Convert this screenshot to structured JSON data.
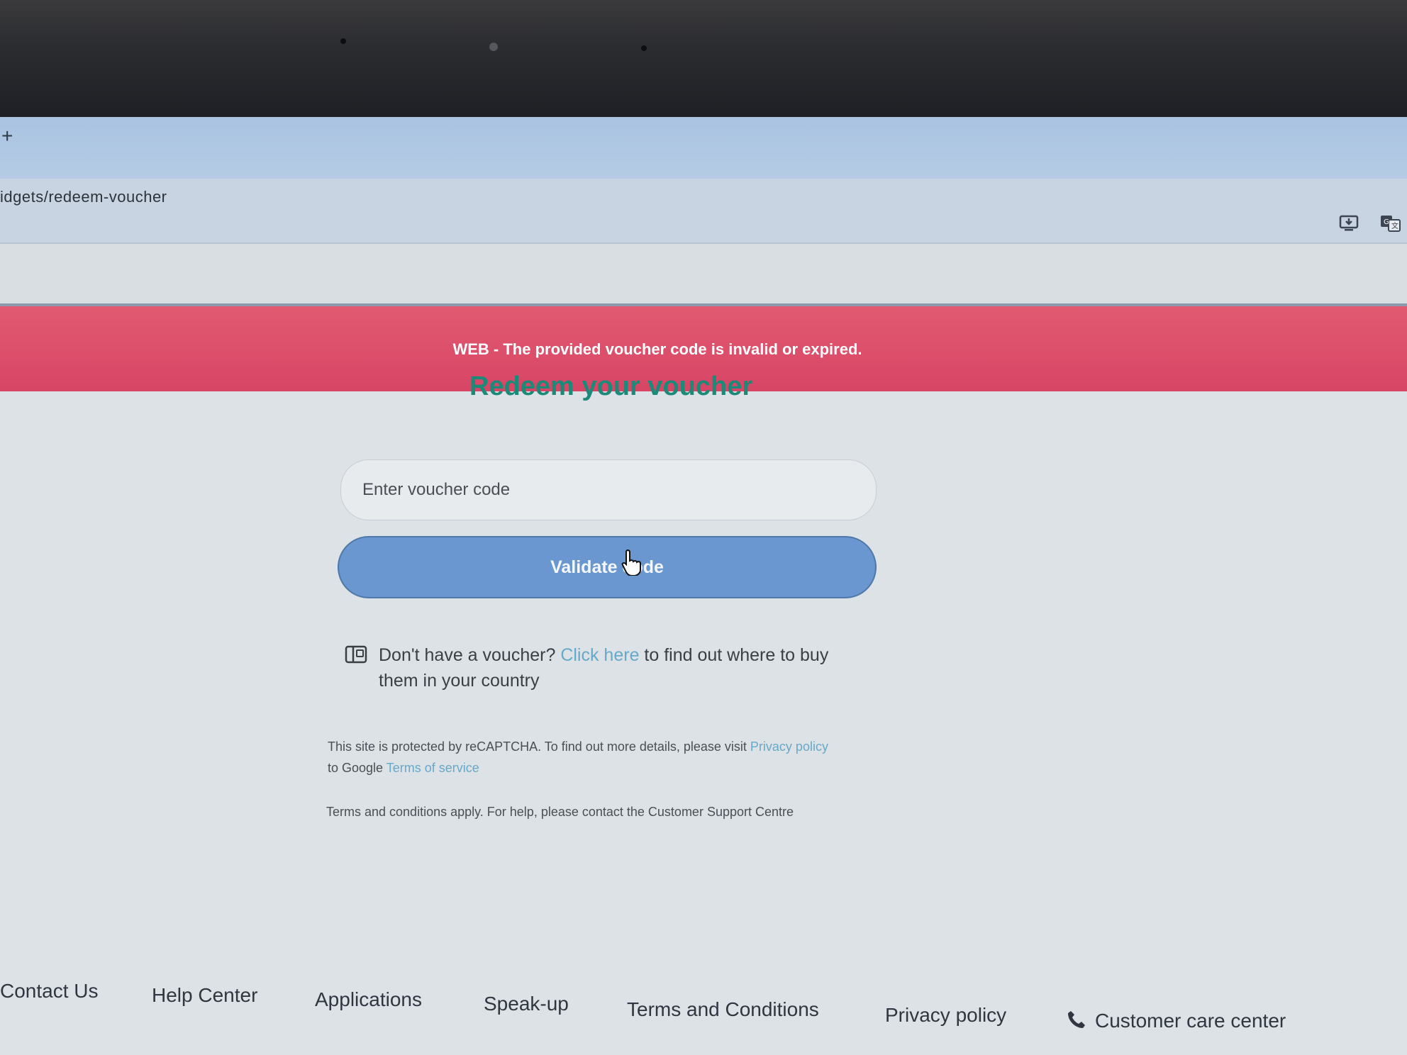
{
  "browser": {
    "new_tab_label": "+",
    "url": "idgets/redeem-voucher",
    "toolbar_icons": [
      "install-app-icon",
      "translate-icon"
    ]
  },
  "alert": {
    "message": "WEB - The provided voucher code is invalid or expired.",
    "color": "#d84566"
  },
  "form": {
    "title": "Redeem your voucher",
    "input_placeholder": "Enter voucher code",
    "submit_label": "Validate code",
    "accent_color": "#1b8a78",
    "button_color": "#6a97cf"
  },
  "info": {
    "icon": "voucher-icon",
    "prefix": "Don't have a voucher? ",
    "link": "Click here",
    "suffix": " to find out where to buy them in your country"
  },
  "recaptcha": {
    "prefix": "This site is protected by reCAPTCHA. To find out more details, please visit ",
    "privacy_link": "Privacy policy",
    "middle": " to Google ",
    "terms_link": "Terms of service"
  },
  "terms_note": "Terms and conditions apply. For help, please contact the Customer Support Centre",
  "footer": {
    "links": [
      "Contact Us",
      "Help Center",
      "Applications",
      "Speak-up",
      "Terms and Conditions",
      "Privacy policy"
    ],
    "customer_care": "Customer care center",
    "customer_care_icon": "phone-icon"
  }
}
